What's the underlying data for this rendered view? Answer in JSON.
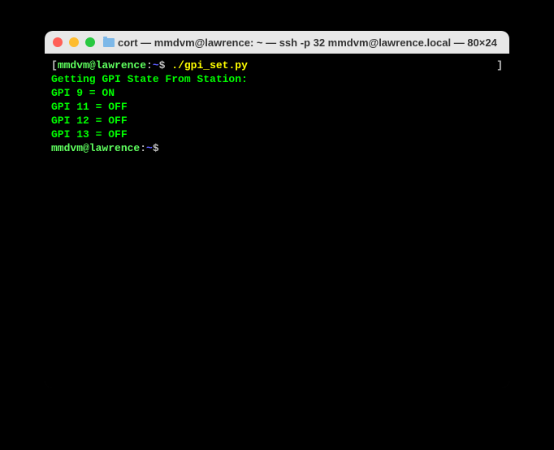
{
  "window": {
    "title": "cort — mmdvm@lawrence: ~ — ssh -p 32 mmdvm@lawrence.local — 80×24"
  },
  "terminal": {
    "bracket_left": "[",
    "bracket_right": "]",
    "prompt1": {
      "user": "mmdvm@lawrence",
      "colon": ":",
      "path": "~",
      "dollar": "$ ",
      "command": "./gpi_set.py"
    },
    "output": {
      "line1": "Getting GPI State From Station:",
      "line2": "GPI 9 = ON",
      "line3": "GPI 11 = OFF",
      "line4": "GPI 12 = OFF",
      "line5": "GPI 13 = OFF"
    },
    "prompt2": {
      "user": "mmdvm@lawrence",
      "colon": ":",
      "path": "~",
      "dollar": "$ "
    }
  }
}
